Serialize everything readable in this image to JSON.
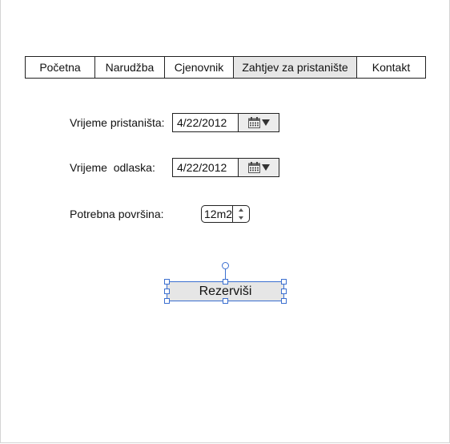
{
  "nav": {
    "tabs": [
      {
        "label": "Početna"
      },
      {
        "label": "Narudžba"
      },
      {
        "label": "Cjenovnik"
      },
      {
        "label": "Zahtjev za pristanište",
        "active": true
      },
      {
        "label": "Kontakt"
      }
    ]
  },
  "form": {
    "arrival": {
      "label": "Vrijeme pristaništa:",
      "value": "4/22/2012"
    },
    "departure": {
      "label": "Vrijeme  odlaska:",
      "value": "4/22/2012"
    },
    "area": {
      "label": "Potrebna površina:",
      "value": "12m2"
    },
    "submit_label": "Rezerviši"
  },
  "icons": {
    "calendar": "calendar-icon",
    "dropdown": "chevron-down-icon",
    "step_up": "arrow-up-icon",
    "step_down": "arrow-down-icon"
  },
  "colors": {
    "active_tab": "#e6e6e6",
    "selection": "#3b6fd0",
    "button_bg": "#e6e6e6"
  }
}
